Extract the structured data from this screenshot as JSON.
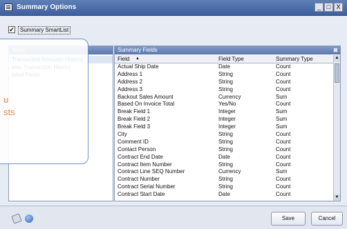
{
  "window": {
    "title": "Summary Options",
    "minimize": "_",
    "maximize": "□",
    "close": "X"
  },
  "checkbox": {
    "label": "Summary SmartList",
    "mark": "✔"
  },
  "left_panel": {
    "header": "ables",
    "items": [
      "Transaction Amounts History",
      "ales Transaction History",
      "lated Fields"
    ]
  },
  "right_panel": {
    "header": "Summary Fields",
    "columns": {
      "field": "Field",
      "field_type": "Field Type",
      "summary_type": "Summary Type",
      "sort_indicator": "▲"
    },
    "rows": [
      [
        "Actual Ship Date",
        "Date",
        "Count"
      ],
      [
        "Address 1",
        "String",
        "Count"
      ],
      [
        "Address 2",
        "String",
        "Count"
      ],
      [
        "Address 3",
        "String",
        "Count"
      ],
      [
        "Backout Sales Amount",
        "Currency",
        "Sum"
      ],
      [
        "Based On Invoice Total",
        "Yes/No",
        "Count"
      ],
      [
        "Break Field 1",
        "Integer",
        "Sum"
      ],
      [
        "Break Field 2",
        "Integer",
        "Sum"
      ],
      [
        "Break Field 3",
        "Integer",
        "Sum"
      ],
      [
        "City",
        "String",
        "Count"
      ],
      [
        "Comment ID",
        "String",
        "Count"
      ],
      [
        "Contact Person",
        "String",
        "Count"
      ],
      [
        "Contract End Date",
        "Date",
        "Count"
      ],
      [
        "Contract Item Number",
        "String",
        "Count"
      ],
      [
        "Contract Line SEQ Number",
        "Currency",
        "Sum"
      ],
      [
        "Contract Number",
        "String",
        "Count"
      ],
      [
        "Contract Serial Number",
        "String",
        "Count"
      ],
      [
        "Contract Start Date",
        "Date",
        "Count"
      ]
    ]
  },
  "callout": {
    "line1": "u",
    "line2": "sts"
  },
  "buttons": {
    "save": "Save",
    "cancel": "Cancel"
  },
  "colors": {
    "title_bar": "#4a6aa8",
    "header_bar": "#6d88bb",
    "callout_text": "#f0843c"
  }
}
